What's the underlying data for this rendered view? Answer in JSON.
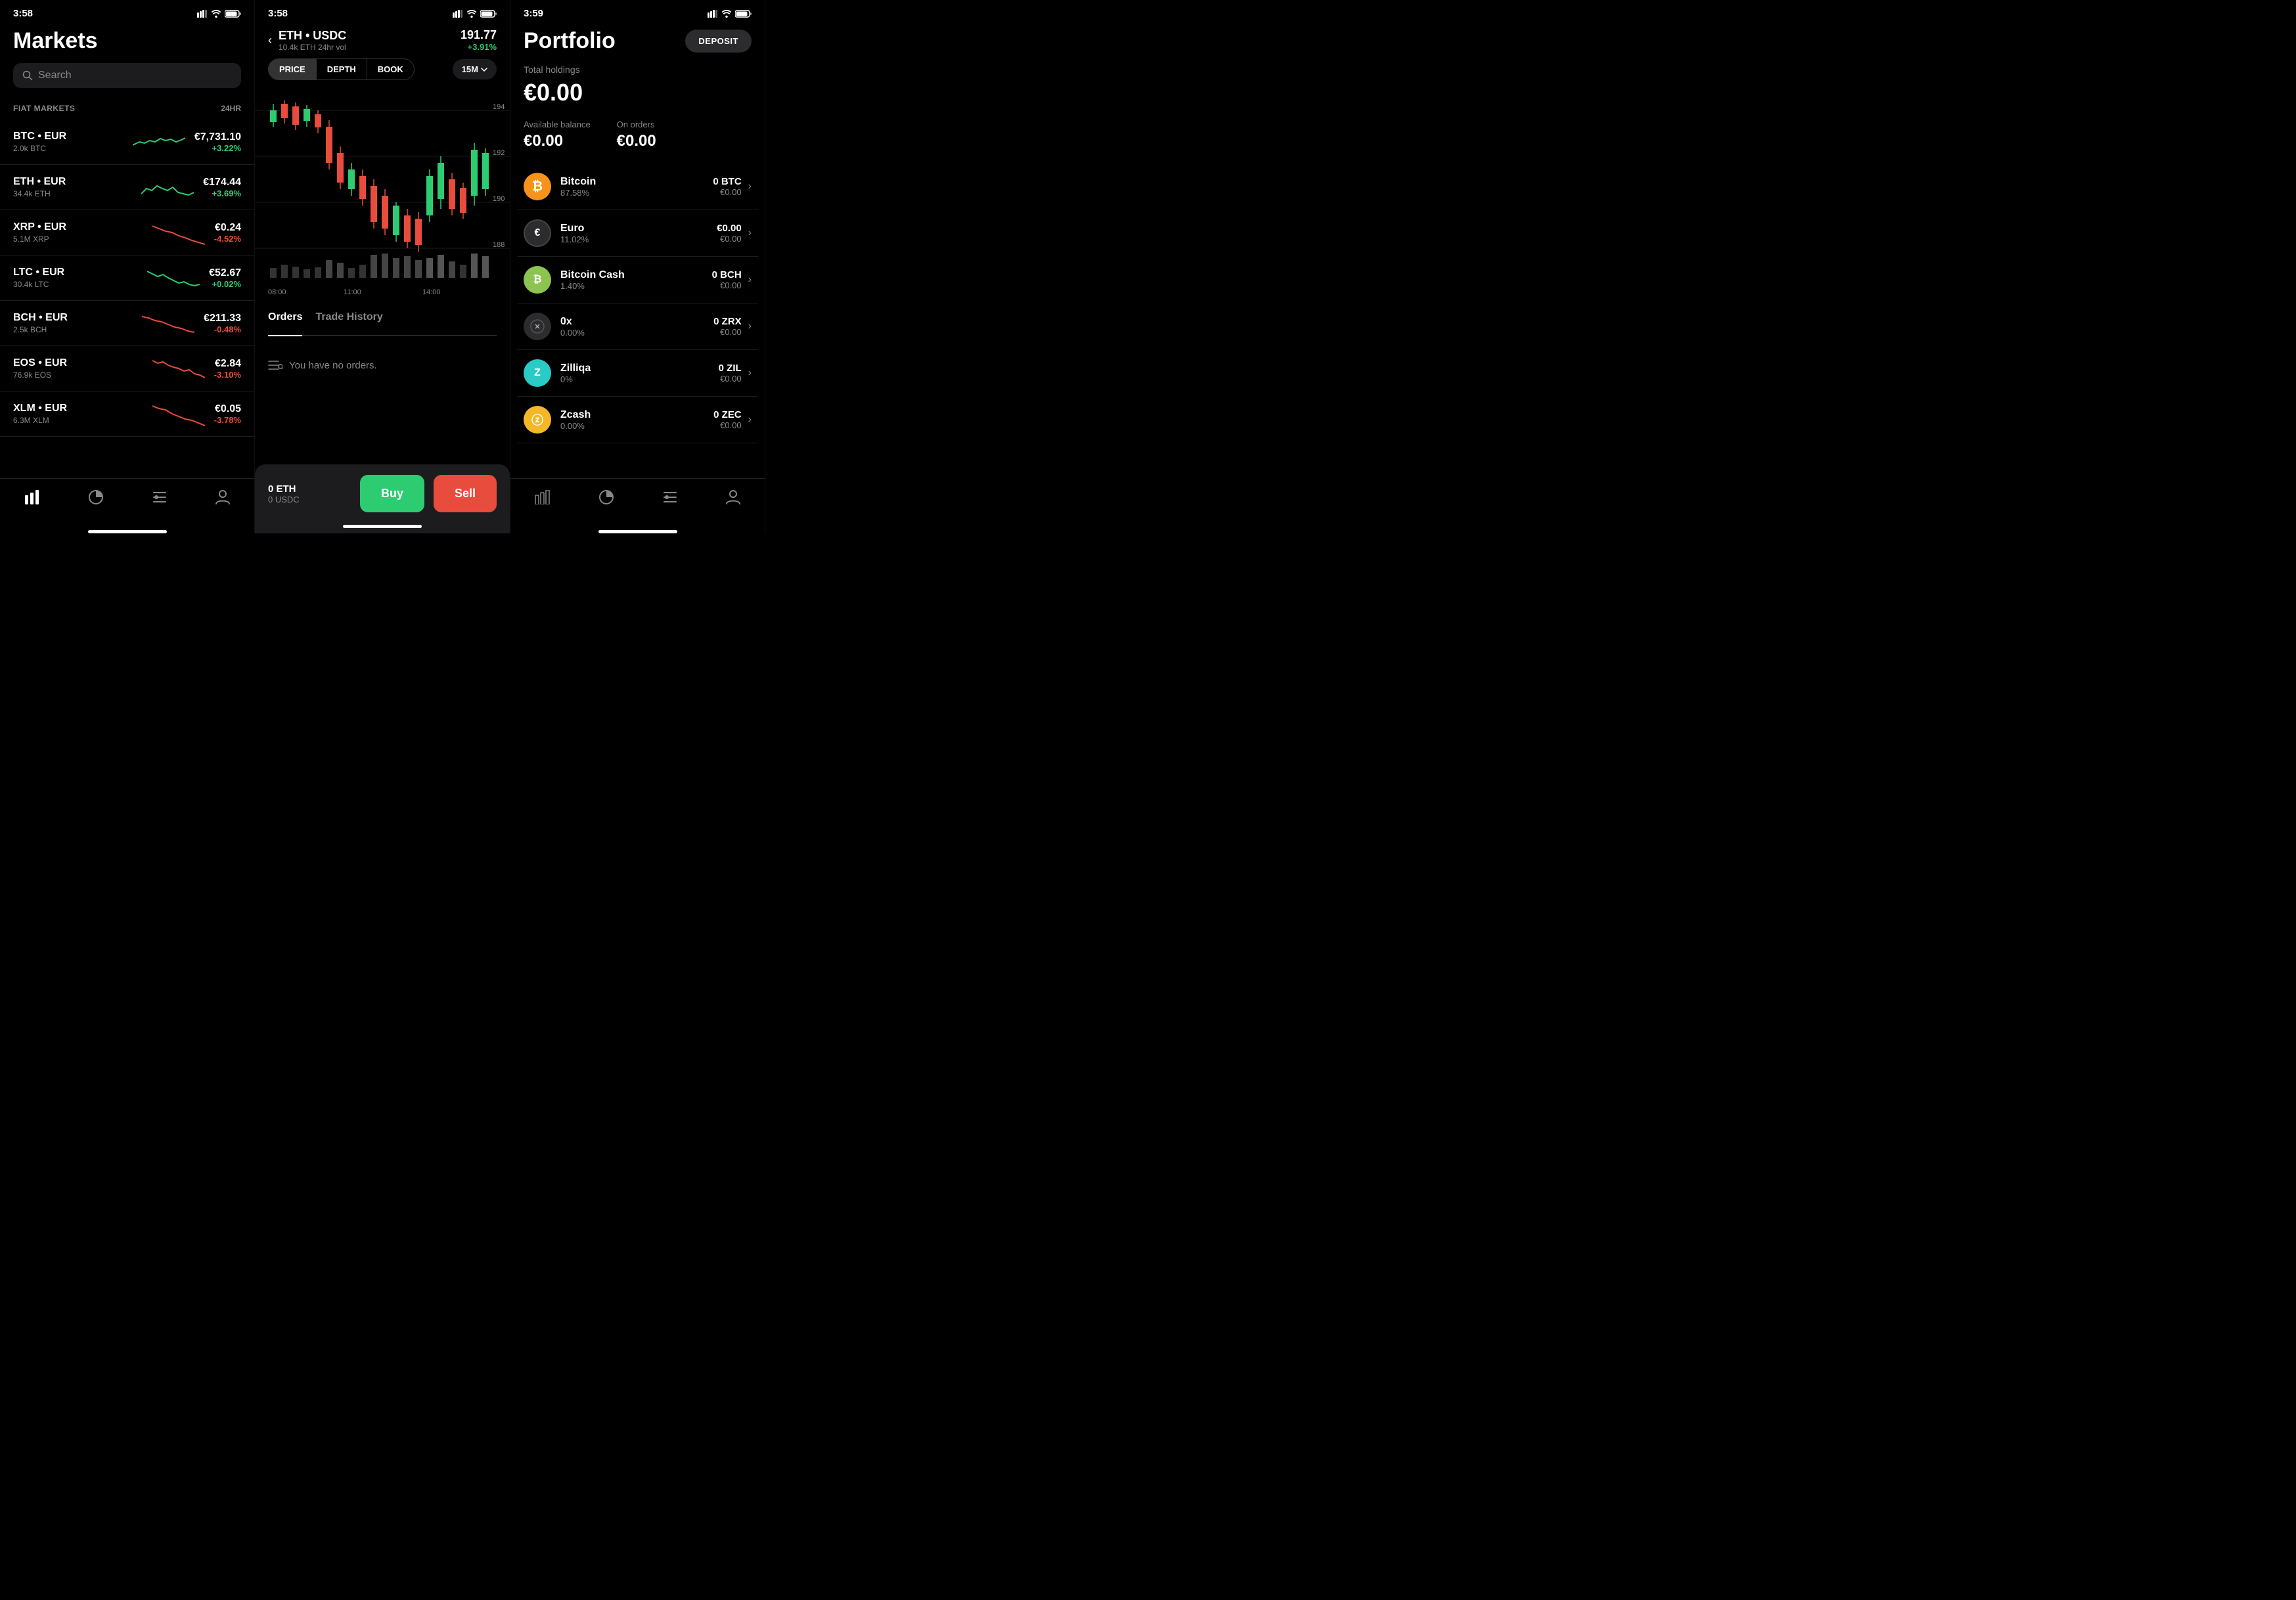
{
  "panel1": {
    "status": {
      "time": "3:58",
      "location": true
    },
    "title": "Markets",
    "search_placeholder": "Search",
    "section_label": "FIAT MARKETS",
    "section_24hr": "24HR",
    "markets": [
      {
        "pair": "BTC • EUR",
        "vol": "2.0k BTC",
        "price": "€7,731.10",
        "change": "+3.22%",
        "positive": true
      },
      {
        "pair": "ETH • EUR",
        "vol": "34.4k ETH",
        "price": "€174.44",
        "change": "+3.69%",
        "positive": true
      },
      {
        "pair": "XRP • EUR",
        "vol": "5.1M XRP",
        "price": "€0.24",
        "change": "-4.52%",
        "positive": false
      },
      {
        "pair": "LTC • EUR",
        "vol": "30.4k LTC",
        "price": "€52.67",
        "change": "+0.02%",
        "positive": true
      },
      {
        "pair": "BCH • EUR",
        "vol": "2.5k BCH",
        "price": "€211.33",
        "change": "-0.48%",
        "positive": false
      },
      {
        "pair": "EOS • EUR",
        "vol": "76.9k EOS",
        "price": "€2.84",
        "change": "-3.10%",
        "positive": false
      },
      {
        "pair": "XLM • EUR",
        "vol": "6.3M XLM",
        "price": "€0.05",
        "change": "-3.78%",
        "positive": false
      }
    ],
    "nav": [
      "chart-bar",
      "pie",
      "list",
      "user"
    ]
  },
  "panel2": {
    "status": {
      "time": "3:58"
    },
    "pair": "ETH • USDC",
    "vol": "10.4k ETH 24hr vol",
    "price": "191.77",
    "change": "+3.91%",
    "tabs": [
      "PRICE",
      "DEPTH",
      "BOOK"
    ],
    "active_tab": "PRICE",
    "timeframe": "15M",
    "chart_labels": [
      "08:00",
      "11:00",
      "14:00"
    ],
    "chart_levels": [
      "194",
      "192",
      "190",
      "188"
    ],
    "orders_tabs": [
      "Orders",
      "Trade History"
    ],
    "active_orders_tab": "Orders",
    "empty_orders": "You have no orders.",
    "eth_balance": "0 ETH",
    "usdc_balance": "0 USDC",
    "buy_label": "Buy",
    "sell_label": "Sell"
  },
  "panel3": {
    "status": {
      "time": "3:59"
    },
    "title": "Portfolio",
    "deposit_label": "DEPOSIT",
    "total_holdings_label": "Total holdings",
    "total_holdings": "€0.00",
    "available_balance_label": "Available balance",
    "available_balance": "€0.00",
    "on_orders_label": "On orders",
    "on_orders": "€0.00",
    "assets": [
      {
        "name": "Bitcoin",
        "pct": "87.58%",
        "amount": "0 BTC",
        "eur": "€0.00",
        "icon": "₿",
        "color": "icon-btc"
      },
      {
        "name": "Euro",
        "pct": "11.02%",
        "amount": "€0.00",
        "eur": "€0.00",
        "icon": "€",
        "color": "icon-eur"
      },
      {
        "name": "Bitcoin Cash",
        "pct": "1.40%",
        "amount": "0 BCH",
        "eur": "€0.00",
        "icon": "₿",
        "color": "icon-bch"
      },
      {
        "name": "0x",
        "pct": "0.00%",
        "amount": "0 ZRX",
        "eur": "€0.00",
        "icon": "✕",
        "color": "icon-zrx"
      },
      {
        "name": "Zilliqa",
        "pct": "0%",
        "amount": "0 ZIL",
        "eur": "€0.00",
        "icon": "Z",
        "color": "icon-zil"
      },
      {
        "name": "Zcash",
        "pct": "0.00%",
        "amount": "0 ZEC",
        "eur": "€0.00",
        "icon": "ⓩ",
        "color": "icon-zec"
      }
    ]
  }
}
